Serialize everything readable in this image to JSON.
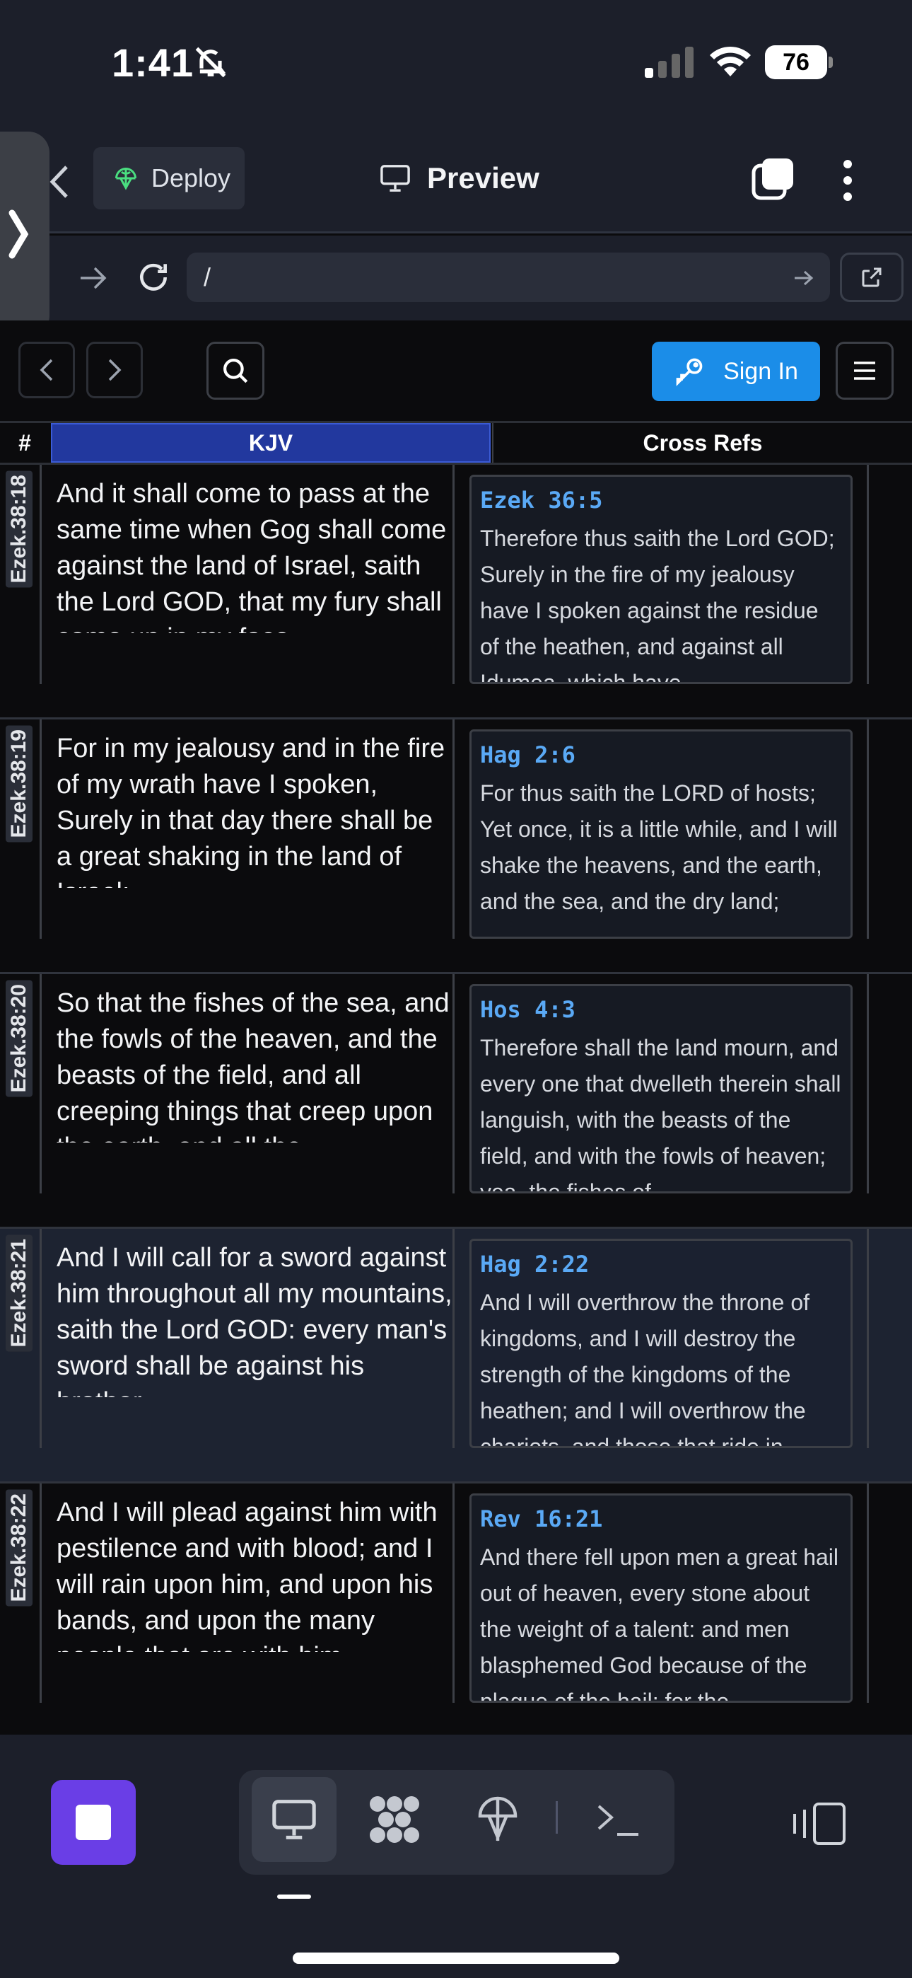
{
  "status": {
    "time": "1:41",
    "battery": "76"
  },
  "toolbar": {
    "deploy_label": "Deploy",
    "preview_label": "Preview"
  },
  "urlbar": {
    "url": "/"
  },
  "nav": {
    "signin_label": "Sign In"
  },
  "table": {
    "headers": {
      "hash": "#",
      "version": "KJV",
      "refs": "Cross Refs"
    },
    "rows": [
      {
        "id": "Ezek.38:18",
        "verse": "And it shall come to pass at the same time when Gog shall come against the land of Israel, saith the Lord GOD, that my fury shall come up in my face.",
        "ref_title": "Ezek 36:5",
        "ref_text": "Therefore thus saith the Lord GOD; Surely in the fire of my jealousy have I spoken against the residue of the heathen, and against all Idumea, which have"
      },
      {
        "id": "Ezek.38:19",
        "verse": "For in my jealousy and in the fire of my wrath have I spoken, Surely in that day there shall be a great shaking in the land of Israel;",
        "ref_title": "Hag 2:6",
        "ref_text": "For thus saith the LORD of hosts; Yet once, it is a little while, and I will shake the heavens, and the earth, and the sea, and the dry land;"
      },
      {
        "id": "Ezek.38:20",
        "verse": "So that the fishes of the sea, and the fowls of the heaven, and the beasts of the field, and all creeping things that creep upon the earth, and all the",
        "ref_title": "Hos 4:3",
        "ref_text": "Therefore shall the land mourn, and every one that dwelleth therein shall languish, with the beasts of the field, and with the fowls of heaven; yea, the fishes of"
      },
      {
        "id": "Ezek.38:21",
        "verse": "And I will call for a sword against him throughout all my mountains, saith the Lord GOD: every man's sword shall be against his brother.",
        "ref_title": "Hag 2:22",
        "ref_text": "And I will overthrow the throne of kingdoms, and I will destroy the strength of the kingdoms of the heathen; and I will overthrow the chariots, and those that ride in"
      },
      {
        "id": "Ezek.38:22",
        "verse": "And I will plead against him with pestilence and with blood; and I will rain upon him, and upon his bands, and upon the many people that are with him,",
        "ref_title": "Rev 16:21",
        "ref_text": "And there fell upon men a great hail out of heaven, every stone about the weight of a talent: and men blasphemed God because of the plague of the hail; for the"
      }
    ]
  }
}
